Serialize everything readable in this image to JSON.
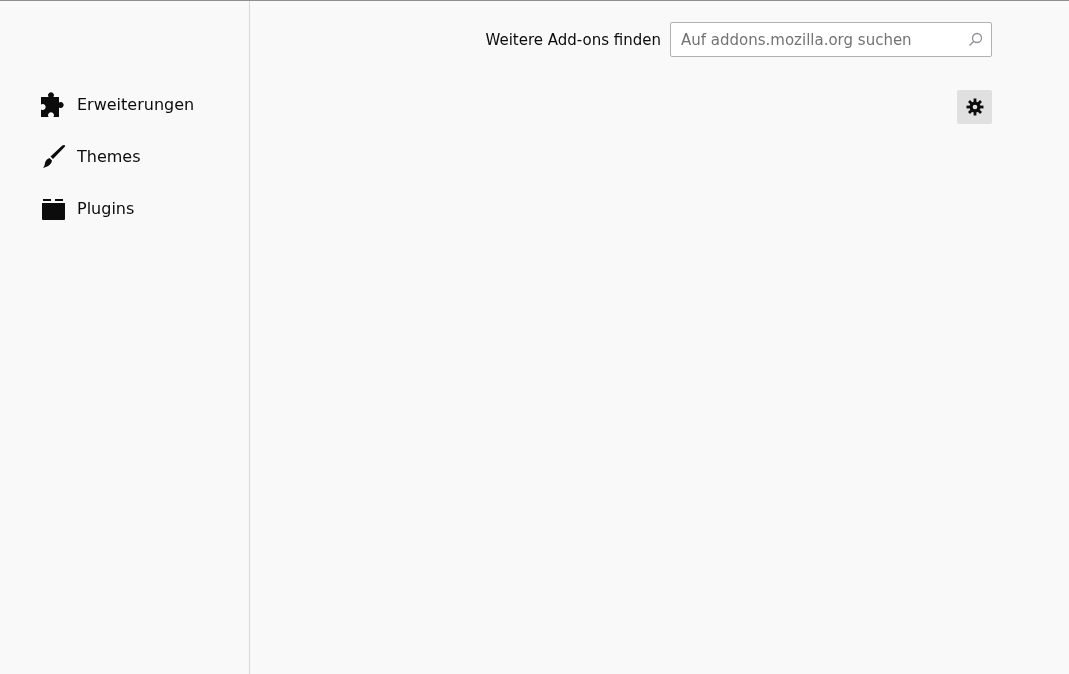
{
  "sidebar": {
    "items": [
      {
        "kind": "extension",
        "label": "Erweiterungen"
      },
      {
        "kind": "theme",
        "label": "Themes"
      },
      {
        "kind": "plugin",
        "label": "Plugins"
      }
    ]
  },
  "header": {
    "find_label": "Weitere Add-ons finden",
    "search": {
      "placeholder": "Auf addons.mozilla.org suchen"
    }
  }
}
